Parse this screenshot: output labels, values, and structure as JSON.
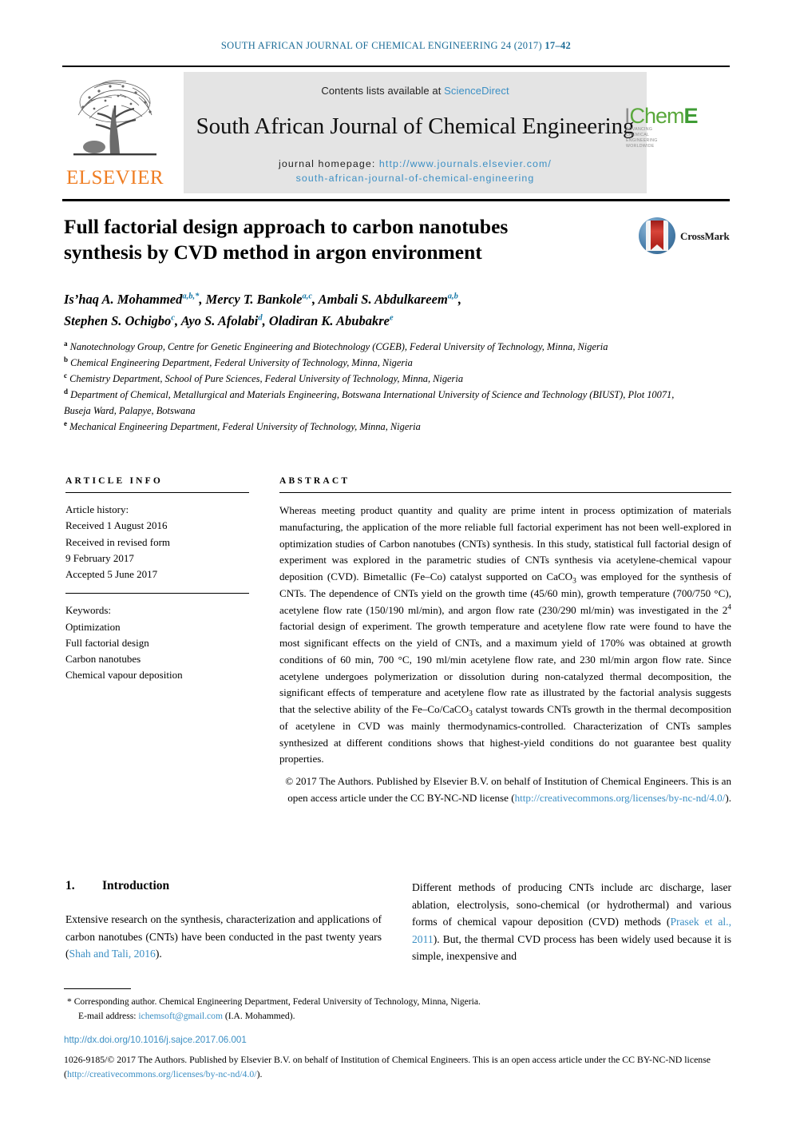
{
  "running_head": {
    "journal": "South African Journal of Chemical Engineering 24 (2017)",
    "pages": "17–42"
  },
  "banner": {
    "contents_prefix": "Contents lists available at ",
    "contents_link": "ScienceDirect",
    "journal_title": "South African Journal of Chemical Engineering",
    "homepage_label": "journal homepage: ",
    "homepage_url_line1": "http://www.journals.elsevier.com/",
    "homepage_url_line2": "south-african-journal-of-chemical-engineering",
    "publisher_logo": "ELSEVIER",
    "society_logo_i": "I",
    "society_logo_chem": "Chem",
    "society_logo_e": "E",
    "society_tagline_1": "ADVANCING",
    "society_tagline_2": "CHEMICAL",
    "society_tagline_3": "ENGINEERING",
    "society_tagline_4": "WORLDWIDE"
  },
  "article": {
    "title_line1": "Full factorial design approach to carbon nanotubes",
    "title_line2": "synthesis by CVD method in argon environment",
    "crossmark_label": "CrossMark",
    "authors": [
      {
        "name": "Is’haq A. Mohammed",
        "marks": "a,b,*"
      },
      {
        "name": "Mercy T. Bankole",
        "marks": "a,c"
      },
      {
        "name": "Ambali S. Abdulkareem",
        "marks": "a,b"
      },
      {
        "name": "Stephen S. Ochigbo",
        "marks": "c"
      },
      {
        "name": "Ayo S. Afolabi",
        "marks": "d"
      },
      {
        "name": "Oladiran K. Abubakre",
        "marks": "e"
      }
    ],
    "affiliations": [
      {
        "mark": "a",
        "text": "Nanotechnology Group, Centre for Genetic Engineering and Biotechnology (CGEB), Federal University of Technology, Minna, Nigeria"
      },
      {
        "mark": "b",
        "text": "Chemical Engineering Department, Federal University of Technology, Minna, Nigeria"
      },
      {
        "mark": "c",
        "text": "Chemistry Department, School of Pure Sciences, Federal University of Technology, Minna, Nigeria"
      },
      {
        "mark": "d",
        "text": "Department of Chemical, Metallurgical and Materials Engineering, Botswana International University of Science and Technology (BIUST), Plot 10071, Buseja Ward, Palapye, Botswana"
      },
      {
        "mark": "e",
        "text": "Mechanical Engineering Department, Federal University of Technology, Minna, Nigeria"
      }
    ]
  },
  "article_info": {
    "heading": "ARTICLE INFO",
    "history_label": "Article history:",
    "history": [
      "Received 1 August 2016",
      "Received in revised form",
      "9 February 2017",
      "Accepted 5 June 2017"
    ],
    "keywords_label": "Keywords:",
    "keywords": [
      "Optimization",
      "Full factorial design",
      "Carbon nanotubes",
      "Chemical vapour deposition"
    ]
  },
  "abstract": {
    "heading": "ABSTRACT",
    "paragraph_part1": "Whereas meeting product quantity and quality are prime intent in process optimization of materials manufacturing, the application of the more reliable full factorial experiment has not been well-explored in optimization studies of Carbon nanotubes (CNTs) synthesis. In this study, statistical full factorial design of experiment was explored in the parametric studies of CNTs synthesis via acetylene-chemical vapour deposition (CVD). Bimetallic (Fe–Co) catalyst supported on CaCO",
    "paragraph_part2": " was employed for the synthesis of CNTs. The dependence of CNTs yield on the growth time (45/60 min), growth temperature (700/750 °C), acetylene flow rate (150/190 ml/min), and argon flow rate (230/290 ml/min) was investigated in the 2",
    "paragraph_part3": " factorial design of experiment. The growth temperature and acetylene flow rate were found to have the most significant effects on the yield of CNTs, and a maximum yield of 170% was obtained at growth conditions of 60 min, 700 °C, 190 ml/min acetylene flow rate, and 230 ml/min argon flow rate. Since acetylene undergoes polymerization or dissolution during non-catalyzed thermal decomposition, the significant effects of temperature and acetylene flow rate as illustrated by the factorial analysis suggests that the selective ability of the Fe–Co/CaCO",
    "paragraph_part4": " catalyst towards CNTs growth in the thermal decomposition of acetylene in CVD was mainly thermodynamics-controlled. Characterization of CNTs samples synthesized at different conditions shows that highest-yield conditions do not guarantee best quality properties.",
    "sub_caco3": "3",
    "sup_factorial": "4",
    "copyright_text": "© 2017 The Authors. Published by Elsevier B.V. on behalf of Institution of Chemical Engineers. This is an open access article under the CC BY-NC-ND license (",
    "copyright_link": "http://creativecommons.org/licenses/by-nc-nd/4.0/",
    "copyright_close": ")."
  },
  "introduction": {
    "number": "1.",
    "title": "Introduction",
    "left_text_1": "Extensive research on the synthesis, characterization and applications of carbon nanotubes (CNTs) have been conducted in the past twenty years (",
    "left_citation": "Shah and Tali, 2016",
    "left_text_2": ").",
    "right_text_1": "Different methods of producing CNTs include arc discharge, laser ablation, electrolysis, sono-chemical (or hydrothermal) and various forms of chemical vapour deposition (CVD) methods (",
    "right_citation": "Prasek et al., 2011",
    "right_text_2": "). But, the thermal CVD process has been widely used because it is simple, inexpensive and"
  },
  "footer": {
    "corresponding_mark": "*",
    "corresponding_text": "Corresponding author. Chemical Engineering Department, Federal University of Technology, Minna, Nigeria.",
    "email_label": "E-mail address: ",
    "email": "ichemsoft@gmail.com",
    "email_owner": " (I.A. Mohammed).",
    "doi": "http://dx.doi.org/10.1016/j.sajce.2017.06.001",
    "issn_text": "1026-9185/© 2017 The Authors. Published by Elsevier B.V. on behalf of Institution of Chemical Engineers. This is an open access article under the CC BY-NC-ND license (",
    "issn_link": "http://creativecommons.org/licenses/by-nc-nd/4.0/",
    "issn_close": ")."
  },
  "colors": {
    "link": "#3c8fc4",
    "runhead": "#1a6b96",
    "elsevier_orange": "#ef7d22",
    "icheme_green": "#5aa83c",
    "banner_gray": "#e4e4e4"
  }
}
